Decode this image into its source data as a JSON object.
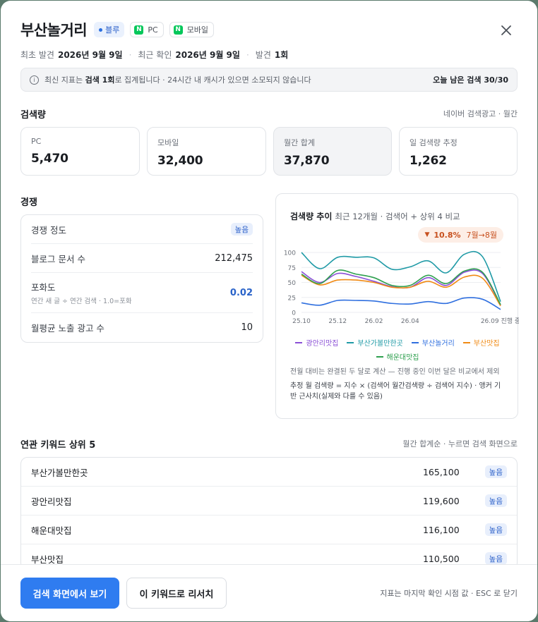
{
  "header": {
    "title": "부산놀거리",
    "tag_blue": "블루",
    "tag_pc": "PC",
    "tag_mobile": "모바일",
    "naver_logo": "N",
    "first_seen_label": "최초 발견",
    "first_seen_value": "2026년 9월 9일",
    "last_check_label": "최근 확인",
    "last_check_value": "2026년 9월 9일",
    "found_label": "발견",
    "found_value": "1회"
  },
  "notice": {
    "icon": "i",
    "text_prefix": "최신 지표는 ",
    "text_bold": "검색 1회",
    "text_suffix": "로 집계됩니다 · 24시간 내 캐시가 있으면 소모되지 않습니다",
    "quota": "오늘 남은 검색 30/30"
  },
  "volume": {
    "title": "검색량",
    "source": "네이버 검색광고 · 월간",
    "cards": [
      {
        "label": "PC",
        "value": "5,470"
      },
      {
        "label": "모바일",
        "value": "32,400"
      },
      {
        "label": "월간 합계",
        "value": "37,870"
      },
      {
        "label": "일 검색량 추정",
        "value": "1,262"
      }
    ]
  },
  "competition": {
    "title": "경쟁",
    "level_label": "경쟁 정도",
    "level_badge": "높음",
    "blog_label": "블로그 문서 수",
    "blog_value": "212,475",
    "saturation_label": "포화도",
    "saturation_sub": "연간 새 글 ÷ 연간 검색 · 1.0=포화",
    "saturation_value": "0.02",
    "ads_label": "월평균 노출 광고 수",
    "ads_value": "10"
  },
  "trend": {
    "title_bold": "검색량 추이",
    "title_rest": "최근 12개월 · 검색어 + 상위 4 비교",
    "delta_value": "10.8%",
    "delta_period": "7월→8월",
    "note1": "전월 대비는 완결된 두 달로 계산 — 진행 중인 이번 달은 비교에서 제외",
    "note2": "추정 월 검색량 = 지수 × (검색어 월간검색량 ÷ 검색어 지수) · 앵커 기반 근사치(실제와 다를 수 있음)"
  },
  "chart_data": {
    "type": "line",
    "x": [
      "25.10",
      "25.11",
      "25.12",
      "26.01",
      "26.02",
      "26.03",
      "26.04",
      "26.05",
      "26.06",
      "26.07",
      "26.08",
      "26.09"
    ],
    "xticks": [
      "25.10",
      "25.12",
      "26.02",
      "26.04",
      "26.09 진행 중"
    ],
    "yticks": [
      "100",
      "75",
      "50",
      "25",
      "0"
    ],
    "ylim": [
      0,
      100
    ],
    "series": [
      {
        "name": "광안리맛집",
        "color": "#8a4fd6",
        "values": [
          68,
          50,
          65,
          60,
          52,
          43,
          42,
          58,
          45,
          67,
          65,
          12
        ]
      },
      {
        "name": "부산가볼만한곳",
        "color": "#1f9aa6",
        "values": [
          100,
          73,
          92,
          92,
          91,
          72,
          76,
          86,
          66,
          97,
          93,
          18
        ]
      },
      {
        "name": "부산놀거리",
        "color": "#2f6fdf",
        "values": [
          16,
          12,
          20,
          20,
          19,
          15,
          14,
          18,
          15,
          24,
          22,
          5
        ]
      },
      {
        "name": "부산맛집",
        "color": "#f08a14",
        "values": [
          62,
          46,
          54,
          54,
          50,
          42,
          42,
          52,
          42,
          59,
          57,
          11
        ]
      },
      {
        "name": "해운대맛집",
        "color": "#2fa04f",
        "values": [
          64,
          48,
          70,
          64,
          58,
          45,
          45,
          62,
          48,
          69,
          67,
          13
        ]
      }
    ]
  },
  "related": {
    "title": "연관 키워드 상위 5",
    "note": "월간 합계순 · 누르면 검색 화면으로",
    "rows": [
      {
        "keyword": "부산가볼만한곳",
        "total": "165,100",
        "level": "높음"
      },
      {
        "keyword": "광안리맛집",
        "total": "119,600",
        "level": "높음"
      },
      {
        "keyword": "해운대맛집",
        "total": "116,100",
        "level": "높음"
      },
      {
        "keyword": "부산맛집",
        "total": "110,500",
        "level": "높음"
      }
    ]
  },
  "footer": {
    "primary_button": "검색 화면에서 보기",
    "secondary_button": "이 키워드로 리서치",
    "note": "지표는 마지막 확인 시점 값 · ESC 로 닫기"
  }
}
